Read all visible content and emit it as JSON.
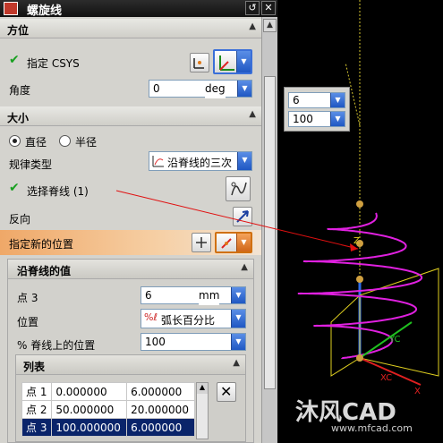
{
  "window": {
    "title": "螺旋线"
  },
  "sections": {
    "orientation": {
      "title": "方位",
      "specify_csys": "指定 CSYS",
      "angle_label": "角度",
      "angle_value": "0",
      "angle_unit": "deg"
    },
    "size": {
      "title": "大小",
      "radio_diameter": "直径",
      "radio_radius": "半径",
      "selected": "diameter",
      "law_type_label": "规律类型",
      "law_type_value": "沿脊线的三次",
      "select_spine": "选择脊线 (1)",
      "reverse": "反向",
      "specify_new_position": "指定新的位置"
    },
    "values_along_spine": {
      "title": "沿脊线的值",
      "point_label": "点 3",
      "point_value": "6",
      "point_unit": "mm",
      "location_label": "位置",
      "location_value": "弧长百分比",
      "percent_label": "% 脊线上的位置",
      "percent_value": "100"
    },
    "list": {
      "title": "列表",
      "rows": [
        {
          "name": "点 1",
          "pos": "0.000000",
          "val": "6.000000"
        },
        {
          "name": "点 2",
          "pos": "50.000000",
          "val": "20.000000"
        },
        {
          "name": "点 3",
          "pos": "100.000000",
          "val": "6.000000"
        }
      ],
      "selected_row": 2
    }
  },
  "viewport": {
    "mini_dialog": {
      "value1": "6",
      "value2": "100"
    },
    "axis_labels": {
      "yc": "YC",
      "xc": "XC",
      "x": "X",
      "z": "Z"
    },
    "watermark": {
      "brand": "沐风CAD",
      "url": "www.mfcad.com"
    }
  },
  "colors": {
    "helix": "#e020e0",
    "accent_orange": "#efa868",
    "selection_blue": "#0a246a",
    "check_green": "#18a020"
  }
}
